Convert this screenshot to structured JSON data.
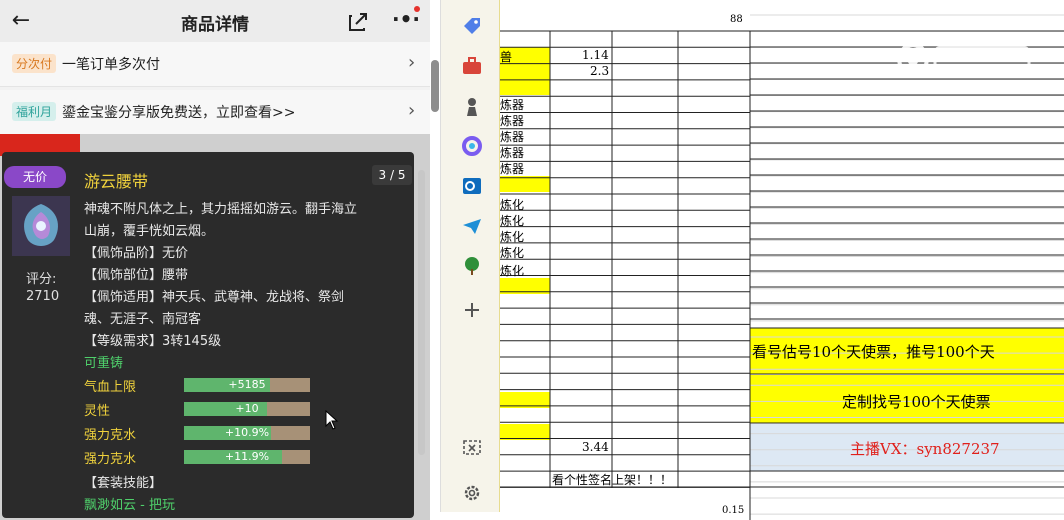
{
  "phone": {
    "title": "商品详情",
    "back_icon": "back-arrow-icon",
    "share_icon": "share-icon",
    "more_icon": "more-icon",
    "rows": [
      {
        "tag": "分次付",
        "tag_color": "#e9a15a",
        "text": "一笔订单多次付",
        "chevron": "›"
      },
      {
        "tag": "福利月",
        "tag_color": "#4bb6b0",
        "text": "鎏金宝鉴分享版免费送，立即查看>>",
        "chevron": "›"
      }
    ]
  },
  "tooltip": {
    "badge": "无价",
    "item_name": "游云腰带",
    "pager": "3 / 5",
    "score_label": "评分:",
    "score_value": "2710",
    "description_lines": [
      "神魂不附凡体之上，其力摇摇如游云。翻手海立",
      "山崩，覆手恍如云烟。"
    ],
    "attributes": [
      "【佩饰品阶】无价",
      "【佩饰部位】腰带",
      "【佩饰适用】神天兵、武尊神、龙战将、祭剑",
      "魂、无涯子、南冠客",
      "【等级需求】3转145级"
    ],
    "recastable": "可重铸",
    "stats": [
      {
        "label": "气血上限",
        "value": "+5185",
        "fill": 0.68
      },
      {
        "label": "灵性",
        "value": "+10",
        "fill": 0.66
      },
      {
        "label": "强力克水",
        "value": "+10.9%",
        "fill": 0.69
      },
      {
        "label": "强力克水",
        "value": "+11.9%",
        "fill": 0.78
      }
    ],
    "set_skill_header": "【套装技能】",
    "set_skill": "飘渺如云 - 把玩"
  },
  "sidebar": {
    "icons": [
      "tag-icon",
      "toolbox-icon",
      "chess-icon",
      "copilot-icon",
      "outlook-icon",
      "send-icon",
      "tree-icon",
      "add-icon"
    ],
    "bottom_icons": [
      "screenshot-icon",
      "settings-icon"
    ]
  },
  "sheet": {
    "top_value": "88",
    "values": [
      "1.14",
      "2.3",
      "3.44"
    ],
    "bottom_value": "0.15",
    "col_a_text": [
      "兽",
      "炼器",
      "炼器",
      "炼器",
      "炼器",
      "炼器",
      "炼化",
      "炼化",
      "炼化",
      "炼化",
      "炼化"
    ],
    "row_note": "看个性签名上架！！！",
    "banner1": "看号估号10个天使票，推号100个天",
    "banner2": "定制找号100个天使票",
    "banner3": "主播VX：syn827237"
  },
  "colors": {
    "yellow": "#ffff00",
    "light_blue": "#dde8f4",
    "red_text": "#e0201b"
  }
}
